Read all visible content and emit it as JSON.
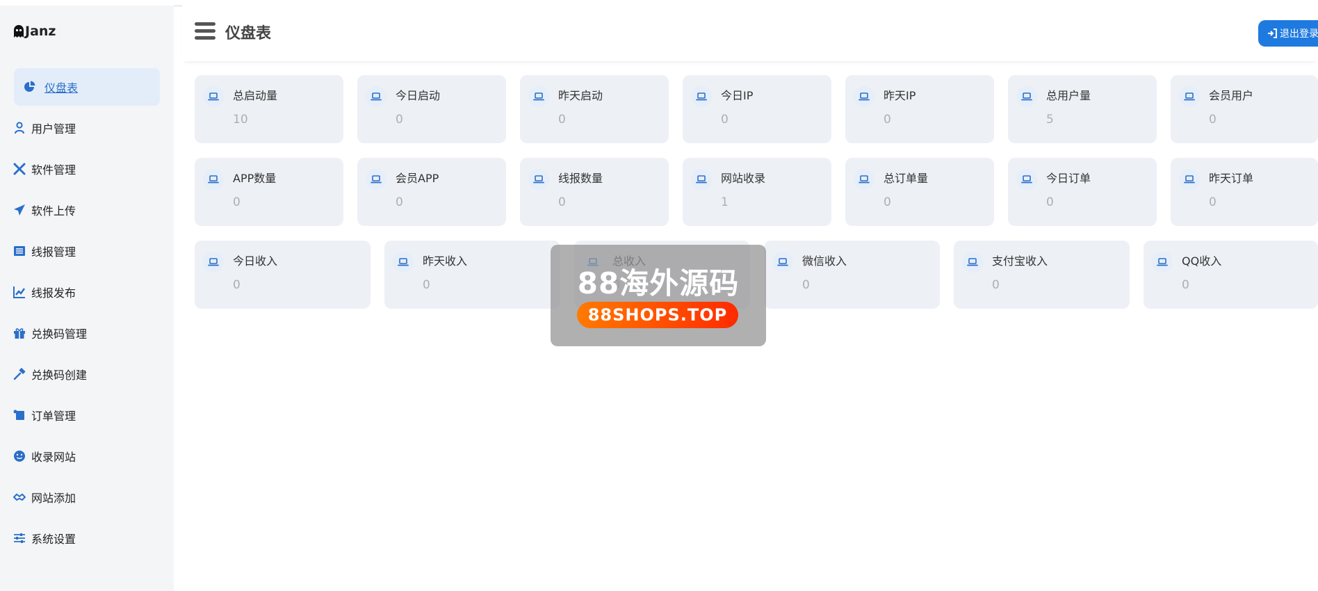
{
  "brand": {
    "name": "Janz"
  },
  "header": {
    "title": "仪盘表",
    "logout_label": "退出登录"
  },
  "sidebar": {
    "items": [
      {
        "label": "仪盘表",
        "icon": "pie-chart-icon",
        "active": true
      },
      {
        "label": "用户管理",
        "icon": "user-icon"
      },
      {
        "label": "软件管理",
        "icon": "tools-icon"
      },
      {
        "label": "软件上传",
        "icon": "paper-plane-icon"
      },
      {
        "label": "线报管理",
        "icon": "list-icon"
      },
      {
        "label": "线报发布",
        "icon": "edit-chart-icon"
      },
      {
        "label": "兑换码管理",
        "icon": "gift-icon"
      },
      {
        "label": "兑换码创建",
        "icon": "hammer-icon"
      },
      {
        "label": "订单管理",
        "icon": "scroll-icon"
      },
      {
        "label": "收录网站",
        "icon": "smile-icon"
      },
      {
        "label": "网站添加",
        "icon": "handshake-icon"
      },
      {
        "label": "系统设置",
        "icon": "sliders-icon"
      }
    ]
  },
  "stats": {
    "row1": [
      {
        "label": "总启动量",
        "value": "10"
      },
      {
        "label": "今日启动",
        "value": "0"
      },
      {
        "label": "昨天启动",
        "value": "0"
      },
      {
        "label": "今日IP",
        "value": "0"
      },
      {
        "label": "昨天IP",
        "value": "0"
      },
      {
        "label": "总用户量",
        "value": "5"
      },
      {
        "label": "会员用户",
        "value": "0"
      }
    ],
    "row2": [
      {
        "label": "APP数量",
        "value": "0"
      },
      {
        "label": "会员APP",
        "value": "0"
      },
      {
        "label": "线报数量",
        "value": "0"
      },
      {
        "label": "网站收录",
        "value": "1"
      },
      {
        "label": "总订单量",
        "value": "0"
      },
      {
        "label": "今日订单",
        "value": "0"
      },
      {
        "label": "昨天订单",
        "value": "0"
      }
    ],
    "row3": [
      {
        "label": "今日收入",
        "value": "0"
      },
      {
        "label": "昨天收入",
        "value": "0"
      },
      {
        "label": "总收入",
        "value": "0"
      },
      {
        "label": "微信收入",
        "value": "0"
      },
      {
        "label": "支付宝收入",
        "value": "0"
      },
      {
        "label": "QQ收入",
        "value": "0"
      }
    ]
  },
  "watermark": {
    "title": "88海外源码",
    "subtitle": "88SHOPS.TOP"
  },
  "colors": {
    "accent": "#1f7ae0",
    "sidebar_bg": "#f4f5f7",
    "card_bg": "#edf0f5",
    "value_gray": "#aab0b8"
  }
}
